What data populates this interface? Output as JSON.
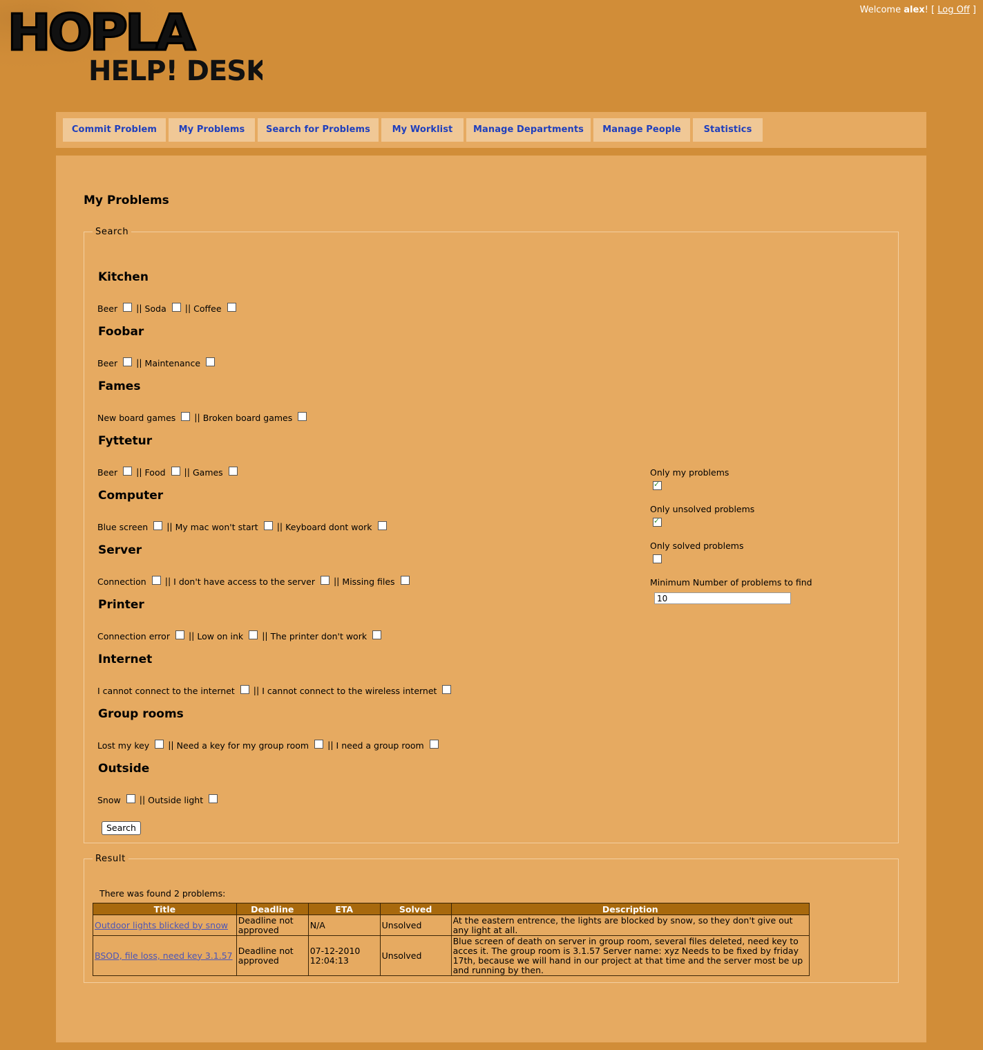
{
  "header": {
    "logo_top": "HOPLA",
    "logo_bottom": "HELP! DESK",
    "welcome_prefix": "Welcome",
    "user": "alex",
    "welcome_suffix": "!",
    "bracket_open": "[",
    "logoff_label": "Log Off",
    "bracket_close": "]"
  },
  "nav": {
    "items": [
      {
        "label": "Commit Problem"
      },
      {
        "label": "My Problems"
      },
      {
        "label": "Search for Problems"
      },
      {
        "label": "My Worklist"
      },
      {
        "label": "Manage Departments"
      },
      {
        "label": "Manage People"
      },
      {
        "label": "Statistics"
      }
    ]
  },
  "page": {
    "title": "My Problems"
  },
  "search": {
    "legend": "Search",
    "separator": "||",
    "departments": [
      {
        "name": "Kitchen",
        "options": [
          "Beer",
          "Soda",
          "Coffee"
        ]
      },
      {
        "name": "Foobar",
        "options": [
          "Beer",
          "Maintenance"
        ]
      },
      {
        "name": "Fames",
        "options": [
          "New board games",
          "Broken board games"
        ]
      },
      {
        "name": "Fyttetur",
        "options": [
          "Beer",
          "Food",
          "Games"
        ]
      },
      {
        "name": "Computer",
        "options": [
          "Blue screen",
          "My mac won't start",
          "Keyboard dont work"
        ]
      },
      {
        "name": "Server",
        "options": [
          "Connection",
          "I don't have access to the server",
          "Missing files"
        ]
      },
      {
        "name": "Printer",
        "options": [
          "Connection error",
          "Low on ink",
          "The printer don't work"
        ]
      },
      {
        "name": "Internet",
        "options": [
          "I cannot connect to the internet",
          "I cannot connect to the wireless internet"
        ]
      },
      {
        "name": "Group rooms",
        "options": [
          "Lost my key",
          "Need a key for my group room",
          "I need a group room"
        ]
      },
      {
        "name": "Outside",
        "options": [
          "Snow",
          "Outside light"
        ]
      }
    ],
    "only_my_label": "Only my problems",
    "only_my_checked": true,
    "only_unsolved_label": "Only unsolved problems",
    "only_unsolved_checked": true,
    "only_solved_label": "Only solved problems",
    "only_solved_checked": false,
    "min_label": "Minimum Number of problems to find",
    "min_value": "10",
    "button_label": "Search"
  },
  "result": {
    "legend": "Result",
    "found_text": "There was found 2 problems:",
    "columns": [
      "Title",
      "Deadline",
      "ETA",
      "Solved",
      "Description"
    ],
    "rows": [
      {
        "title": "Outdoor lights blicked by snow",
        "deadline": "Deadline not approved",
        "eta": "N/A",
        "solved": "Unsolved",
        "description": "At the eastern entrence, the lights are blocked by snow, so they don't give out any light at all."
      },
      {
        "title": "BSOD, file loss, need key 3.1.57",
        "deadline": "Deadline not approved",
        "eta": "07-12-2010 12:04:13",
        "solved": "Unsolved",
        "description": "Blue screen of death on server in group room, several files deleted, need key to acces it. The group room is 3.1.57 Server name: xyz Needs to be fixed by friday 17th, because we will hand in our project at that time and the server most be up and running by then."
      }
    ]
  }
}
